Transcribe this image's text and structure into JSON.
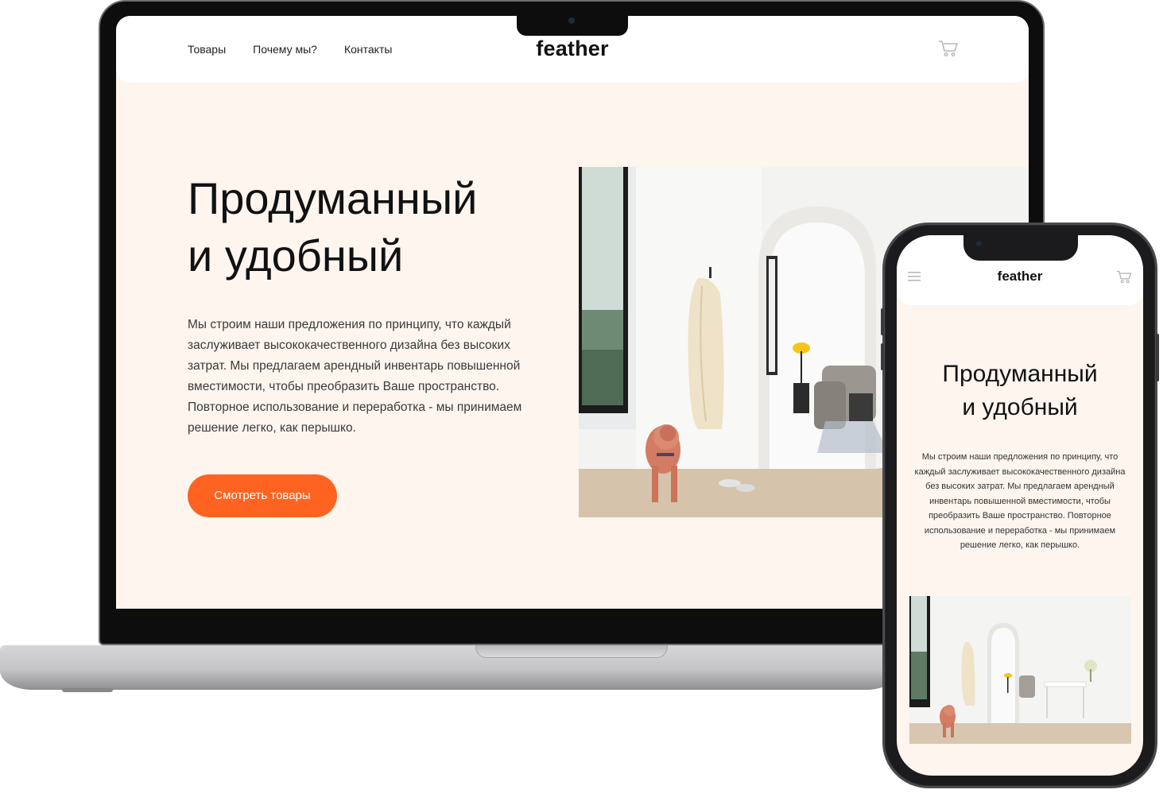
{
  "brand": {
    "name": "feather",
    "accent_color": "#ff6321",
    "background_color": "#fdf5ee"
  },
  "nav": {
    "items": [
      "Товары",
      "Почему мы?",
      "Контакты"
    ]
  },
  "hero": {
    "title_line1": "Продуманный",
    "title_line2": "и удобный",
    "description": "Мы строим наши предложения по принципу, что каждый заслуживает высококачественного дизайна без высоких затрат. Мы предлагаем арендный инвентарь повышенной вместимости, чтобы преобразить Ваше пространство. Повторное использование и переработка - мы принимаем решение легко, как перышко.",
    "cta_label": "Смотреть товары"
  },
  "icons": {
    "cart": "cart-icon",
    "menu": "menu-icon",
    "hero_image": "interior-photo-with-dog"
  }
}
